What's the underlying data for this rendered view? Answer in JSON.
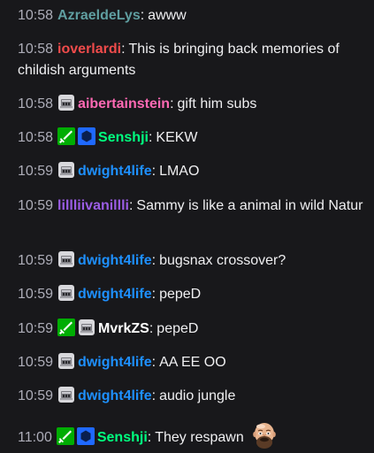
{
  "colors": {
    "background": "#18181b",
    "text": "#efeff1",
    "timestamp": "#adadb8"
  },
  "messages": [
    {
      "time": "10:58",
      "user": "AzraeldeLys",
      "user_color": "#5f9ea0",
      "badges": [],
      "text": "awww"
    },
    {
      "time": "10:58",
      "user": "ioverlardi",
      "user_color": "#ef4b4b",
      "badges": [],
      "text": "This is bringing back memories of childish arguments"
    },
    {
      "time": "10:58",
      "user": "aibertainstein",
      "user_color": "#ff69b4",
      "badges": [
        "sub-gifter-icon"
      ],
      "text": "gift him subs"
    },
    {
      "time": "10:58",
      "user": "Senshji",
      "user_color": "#00ff7f",
      "badges": [
        "moderator-sword-icon",
        "verified-hexagon-icon"
      ],
      "text": "KEKW"
    },
    {
      "time": "10:59",
      "user": "dwight4life",
      "user_color": "#1e90ff",
      "badges": [
        "sub-gifter-icon"
      ],
      "text": "LMAO"
    },
    {
      "time": "10:59",
      "user": "lillliivanillli",
      "user_color": "#9b5de5",
      "badges": [],
      "text": "Sammy is like a animal in wild Natur"
    },
    {
      "time": "10:59",
      "user": "dwight4life",
      "user_color": "#1e90ff",
      "badges": [
        "sub-gifter-icon"
      ],
      "text": "bugsnax crossover?"
    },
    {
      "time": "10:59",
      "user": "dwight4life",
      "user_color": "#1e90ff",
      "badges": [
        "sub-gifter-icon"
      ],
      "text": "pepeD"
    },
    {
      "time": "10:59",
      "user": "MvrkZS",
      "user_color": "#ffffff",
      "badges": [
        "moderator-sword-icon",
        "sub-gifter-icon"
      ],
      "text": "pepeD"
    },
    {
      "time": "10:59",
      "user": "dwight4life",
      "user_color": "#1e90ff",
      "badges": [
        "sub-gifter-icon"
      ],
      "text": "AA EE OO"
    },
    {
      "time": "10:59",
      "user": "dwight4life",
      "user_color": "#1e90ff",
      "badges": [
        "sub-gifter-icon"
      ],
      "text": "audio jungle"
    },
    {
      "time": "11:00",
      "user": "Senshji",
      "user_color": "#00ff7f",
      "badges": [
        "moderator-sword-icon",
        "verified-hexagon-icon"
      ],
      "text": "They respawn",
      "emote": "bald-man-emote-icon"
    }
  ]
}
